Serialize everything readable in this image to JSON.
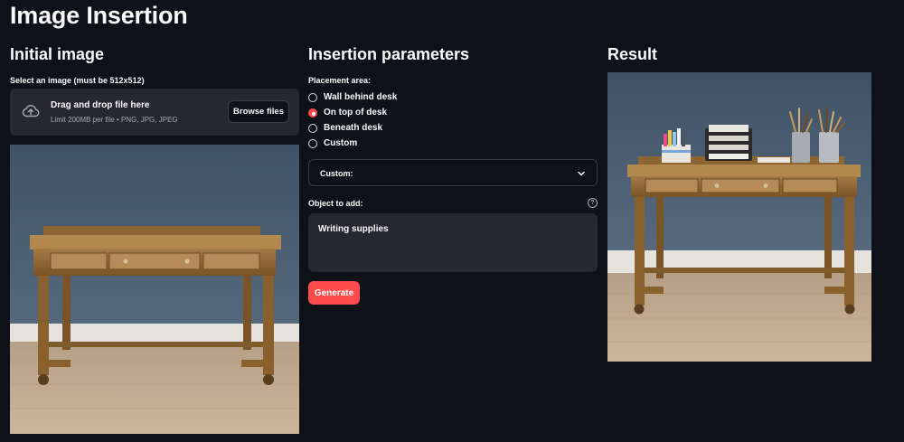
{
  "page": {
    "title": "Image Insertion"
  },
  "left": {
    "title": "Initial image",
    "uploader_label": "Select an image (must be 512x512)",
    "dropzone_title": "Drag and drop file here",
    "dropzone_limits": "Limit 200MB per file • PNG, JPG, JPEG",
    "browse_label": "Browse files",
    "upload_icon": "cloud-upload-icon"
  },
  "middle": {
    "title": "Insertion parameters",
    "placement_label": "Placement area:",
    "options": [
      {
        "label": "Wall behind desk",
        "selected": false
      },
      {
        "label": "On top of desk",
        "selected": true
      },
      {
        "label": "Beneath desk",
        "selected": false
      },
      {
        "label": "Custom",
        "selected": false
      }
    ],
    "custom_select_value": "Custom:",
    "object_label": "Object to add:",
    "object_value": "Writing supplies",
    "help_glyph": "?",
    "generate_label": "Generate"
  },
  "right": {
    "title": "Result"
  },
  "colors": {
    "background": "#0e1117",
    "panel": "#262730",
    "accent": "#ff4b4b",
    "text": "#fafafa",
    "muted": "#a3a8b8"
  }
}
